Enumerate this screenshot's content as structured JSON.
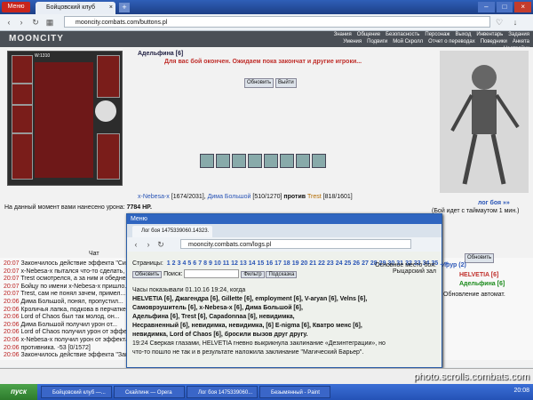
{
  "browser": {
    "menu_label": "Меню",
    "tab_title": "Бойцовский клуб",
    "url": "mooncity.combats.com/buttons.pl"
  },
  "game": {
    "logo": "MOONCITY",
    "menu": [
      "Знания",
      "Общение",
      "Безопасность",
      "Персонаж",
      "Выход",
      "Инвентарь",
      "Задания",
      "Умения",
      "Подвиги",
      "Мой Скролл",
      "Отчет о переводах",
      "Поведники",
      "Анкета",
      "Настройки"
    ],
    "character": "Адельфина [6]",
    "char_stats": [
      "W:1310",
      "M:1084/1084"
    ],
    "wait_message": "Для вас бой окончен. Ожидаем пока закончат и другие игроки...",
    "refresh_btn": "Обновить",
    "exit_btn": "Выйти",
    "fight_left": "x-Nebesa-x",
    "fight_left_hp": "[1674/2031]",
    "fight_mid": "Дима Большой",
    "fight_mid_hp": "[510/1270]",
    "vs": "против",
    "fight_right": "Trest",
    "fight_right_hp": "[818/1601]",
    "damage_line": "На данный момент вами нанесено урона:",
    "damage_value": "7784 HP.",
    "log_link": "лог боя »»",
    "timeout": "(Бой идет с таймаутом 1 мин.)",
    "chat_tab": "Чат",
    "update_btn": "Обновить"
  },
  "chat": [
    {
      "time": "20:07",
      "text": "Закончилось действие эффекта \"Сила Ареса\" для x-Nebesa-x"
    },
    {
      "time": "20:07",
      "text": "x-Nebesa-x пытался что-то сделать, но стрелой в нос врага. -35 [1674/2031]"
    },
    {
      "time": "20:07",
      "text": "Trest осмотрелся, а за ним и обедненной глины пах оппонента. -23"
    },
    {
      "time": "20:07",
      "text": "Бойцу по имени x-Nebesa-x пришло..."
    },
    {
      "time": "20:07",
      "text": "Trest, сам не понял зачем, примел..."
    },
    {
      "time": "20:06",
      "text": "Дима Большой, понял, пропустил..."
    },
    {
      "time": "20:06",
      "text": "Кроличья лапка, подкова в перчатке..."
    },
    {
      "time": "20:06",
      "text": "Lord of Chaos был так молод, он..."
    },
    {
      "time": "20:06",
      "text": "Дима Большой получил урон от..."
    },
    {
      "time": "20:06",
      "text": "Lord of Chaos получил урон от эффекта..."
    },
    {
      "time": "20:06",
      "text": "x-Nebesa-x получил урон от эффекта..."
    },
    {
      "time": "20:06",
      "text": "противника. -53 [0/1572]"
    },
    {
      "time": "20:06",
      "text": "Закончилось действие эффекта \"Занять позицию от защиты\" для Lord of Chaos"
    }
  ],
  "online": {
    "title": "Ирур (2)",
    "users": [
      "HELVETIA [6]",
      "Адельфина [6]"
    ],
    "note": "Обновление автомат."
  },
  "popup": {
    "menu_label": "Меню",
    "tab_title": "Лог боя 1475339060.14323.",
    "url": "mooncity.combats.com/logs.pl",
    "pages_label": "Страницы:",
    "pages": [
      "1",
      "2",
      "3",
      "4",
      "5",
      "6",
      "7",
      "8",
      "9",
      "10",
      "11",
      "12",
      "13",
      "14",
      "15",
      "16",
      "17",
      "18",
      "19",
      "20",
      "21",
      "22",
      "23",
      "24",
      "25",
      "26",
      "27",
      "28",
      "29",
      "30",
      "31",
      "32",
      "33",
      "34",
      "35",
      "..",
      "»"
    ],
    "refresh": "Обновить",
    "search_label": "Поиск:",
    "filter": "Фильтр",
    "hint": "Подсказка",
    "location_label": "Основное место боя:",
    "location": "Рыцарский зал",
    "log_header": "Часы показывали 01.10.16 19:24, когда",
    "log_lines": [
      "HELVETIA [6], Джагендра [6], Gillette [6], employment [6], V-aryan [6], Velns [6],",
      "Самоврэушитель [6], x-Nebesa-x [6], Дима Большой [6],",
      "Адельфина [6], Trest [6], Capadonnaa [6], невидимка,",
      "Несравненный [6], невидимка, невидимка, [6] E-nigma [6], Кватро менс [6],",
      "невидимка, Lord of Chaos [6], бросили вызов друг другу.",
      "19:24 Сверкая глазами, HELVETIA гневно выкрикнула заклинание «Дезинтеграции», но",
      "что-то пошло не так и в результате наложила заклинание \"Магический Барьер\"."
    ]
  },
  "taskbar": {
    "start": "пуск",
    "tasks": [
      "Бойцовский клуб —...",
      "Скайлинк — Opera",
      "Лог боя 1475339060...",
      "Безымянный - Paint"
    ],
    "clock": "20:08"
  },
  "watermark": "photo.scrolls.combats.com"
}
